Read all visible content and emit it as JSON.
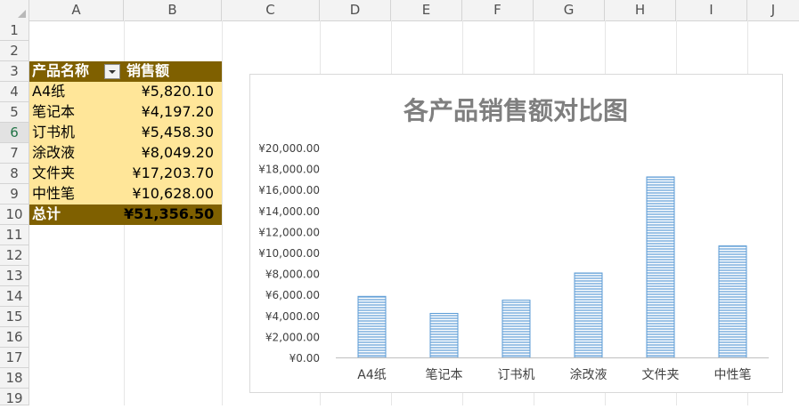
{
  "columns": [
    "A",
    "B",
    "C",
    "D",
    "E",
    "F",
    "G",
    "H",
    "I",
    "J"
  ],
  "rows": [
    "1",
    "2",
    "3",
    "4",
    "5",
    "6",
    "7",
    "8",
    "9",
    "10",
    "11",
    "12",
    "13",
    "14",
    "15",
    "16",
    "17",
    "18",
    "19"
  ],
  "selected_row": "6",
  "table": {
    "header": {
      "name": "产品名称",
      "sales": "销售额"
    },
    "rows": [
      {
        "name": "A4纸",
        "sales": "¥5,820.10"
      },
      {
        "name": "笔记本",
        "sales": "¥4,197.20"
      },
      {
        "name": "订书机",
        "sales": "¥5,458.30"
      },
      {
        "name": "涂改液",
        "sales": "¥8,049.20"
      },
      {
        "name": "文件夹",
        "sales": "¥17,203.70"
      },
      {
        "name": "中性笔",
        "sales": "¥10,628.00"
      }
    ],
    "total": {
      "label": "总计",
      "value": "¥51,356.50"
    }
  },
  "colors": {
    "header_fill": "#7f6000",
    "body_fill": "#ffe699",
    "bar_fill": "#9dc3e6",
    "bar_stroke": "#5b9bd5"
  },
  "chart_data": {
    "type": "bar",
    "title": "各产品销售额对比图",
    "categories": [
      "A4纸",
      "笔记本",
      "订书机",
      "涂改液",
      "文件夹",
      "中性笔"
    ],
    "values": [
      5820.1,
      4197.2,
      5458.3,
      8049.2,
      17203.7,
      10628.0
    ],
    "ylim": [
      0,
      20000
    ],
    "yticks": [
      "¥0.00",
      "¥2,000.00",
      "¥4,000.00",
      "¥6,000.00",
      "¥8,000.00",
      "¥10,000.00",
      "¥12,000.00",
      "¥14,000.00",
      "¥16,000.00",
      "¥18,000.00",
      "¥20,000.00"
    ],
    "grid": false,
    "legend": "none"
  }
}
